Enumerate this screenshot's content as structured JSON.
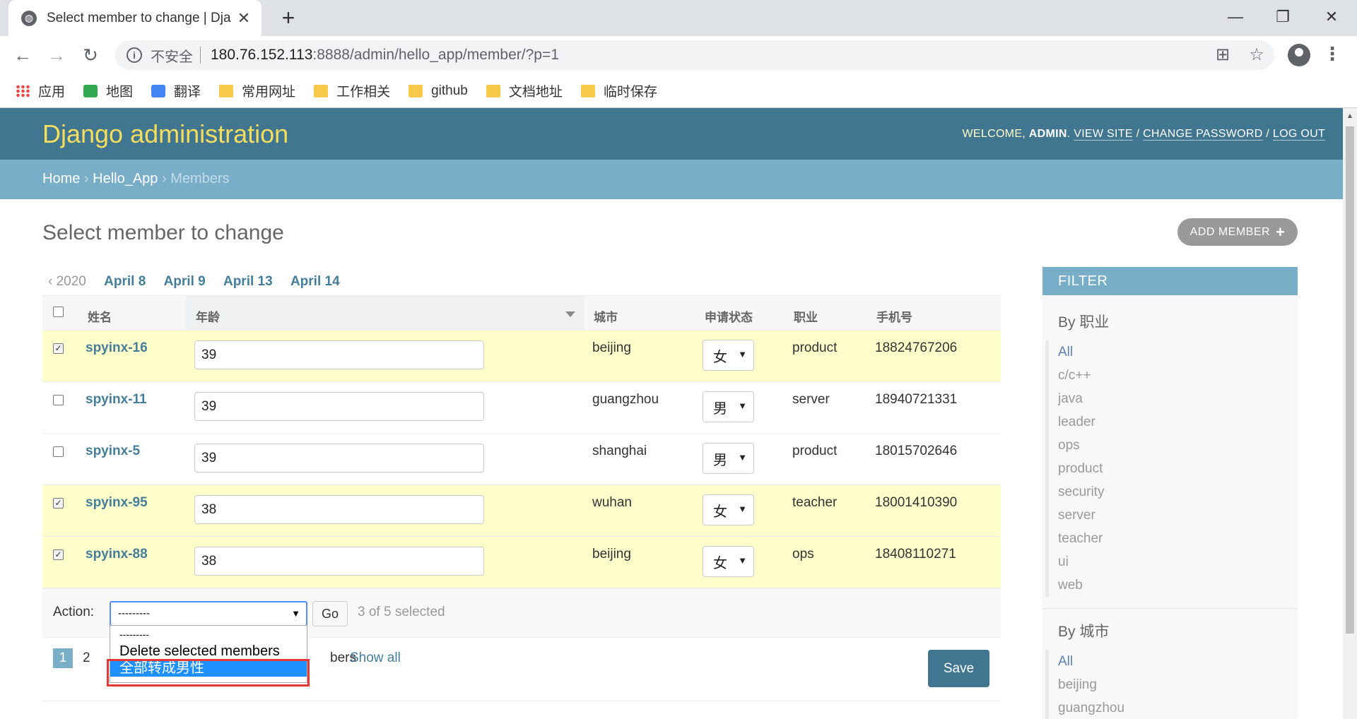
{
  "browser": {
    "tab_title": "Select member to change | Dja",
    "tab_close": "✕",
    "new_tab": "+",
    "win_min": "—",
    "win_max": "❐",
    "win_close": "✕",
    "back": "←",
    "forward": "→",
    "reload": "↻",
    "info": "i",
    "insecure_label": "不安全",
    "url_host": "180.76.152.113",
    "url_rest": ":8888/admin/hello_app/member/?p=1",
    "translate_icon": "⊞",
    "star_icon": "☆",
    "menu_icon": "⋮",
    "bookmarks": [
      "应用",
      "地图",
      "翻译",
      "常用网址",
      "工作相关",
      "github",
      "文档地址",
      "临时保存"
    ]
  },
  "header": {
    "brand": "Django administration",
    "welcome": "WELCOME, ",
    "user": "ADMIN",
    "view_site": "VIEW SITE",
    "change_password": "CHANGE PASSWORD",
    "log_out": "LOG OUT",
    "sep": " / ",
    "dot": ". "
  },
  "breadcrumbs": {
    "home": "Home",
    "app": "Hello_App",
    "current": "Members",
    "sep": " › "
  },
  "content": {
    "title": "Select member to change",
    "add_button": "ADD MEMBER",
    "add_icon": "+"
  },
  "date_hierarchy": {
    "back": "‹ 2020",
    "links": [
      "April 8",
      "April 9",
      "April 13",
      "April 14"
    ]
  },
  "table": {
    "headers": [
      "姓名",
      "年龄",
      "城市",
      "申请状态",
      "职业",
      "手机号"
    ],
    "rows": [
      {
        "checked": true,
        "name": "spyinx-16",
        "age": "39",
        "city": "beijing",
        "gender": "女",
        "job": "product",
        "phone": "18824767206"
      },
      {
        "checked": false,
        "name": "spyinx-11",
        "age": "39",
        "city": "guangzhou",
        "gender": "男",
        "job": "server",
        "phone": "18940721331"
      },
      {
        "checked": false,
        "name": "spyinx-5",
        "age": "39",
        "city": "shanghai",
        "gender": "男",
        "job": "product",
        "phone": "18015702646"
      },
      {
        "checked": true,
        "name": "spyinx-95",
        "age": "38",
        "city": "wuhan",
        "gender": "女",
        "job": "teacher",
        "phone": "18001410390"
      },
      {
        "checked": true,
        "name": "spyinx-88",
        "age": "38",
        "city": "beijing",
        "gender": "女",
        "job": "ops",
        "phone": "18408110271"
      }
    ]
  },
  "actions": {
    "label": "Action:",
    "selected": "---------",
    "go": "Go",
    "counter": "3 of 5 selected",
    "options": [
      "---------",
      "Delete selected members",
      "全部转成男性"
    ],
    "highlighted": 2
  },
  "paginator": {
    "current": "1",
    "page2": "2",
    "count_fragment": "bers",
    "show_all": "Show all"
  },
  "save": "Save",
  "filter": {
    "title": "FILTER",
    "sections": [
      {
        "title": "By 职业",
        "items": [
          "All",
          "c/c++",
          "java",
          "leader",
          "ops",
          "product",
          "security",
          "server",
          "teacher",
          "ui",
          "web"
        ]
      },
      {
        "title": "By 城市",
        "items": [
          "All",
          "beijing",
          "guangzhou"
        ]
      }
    ]
  }
}
